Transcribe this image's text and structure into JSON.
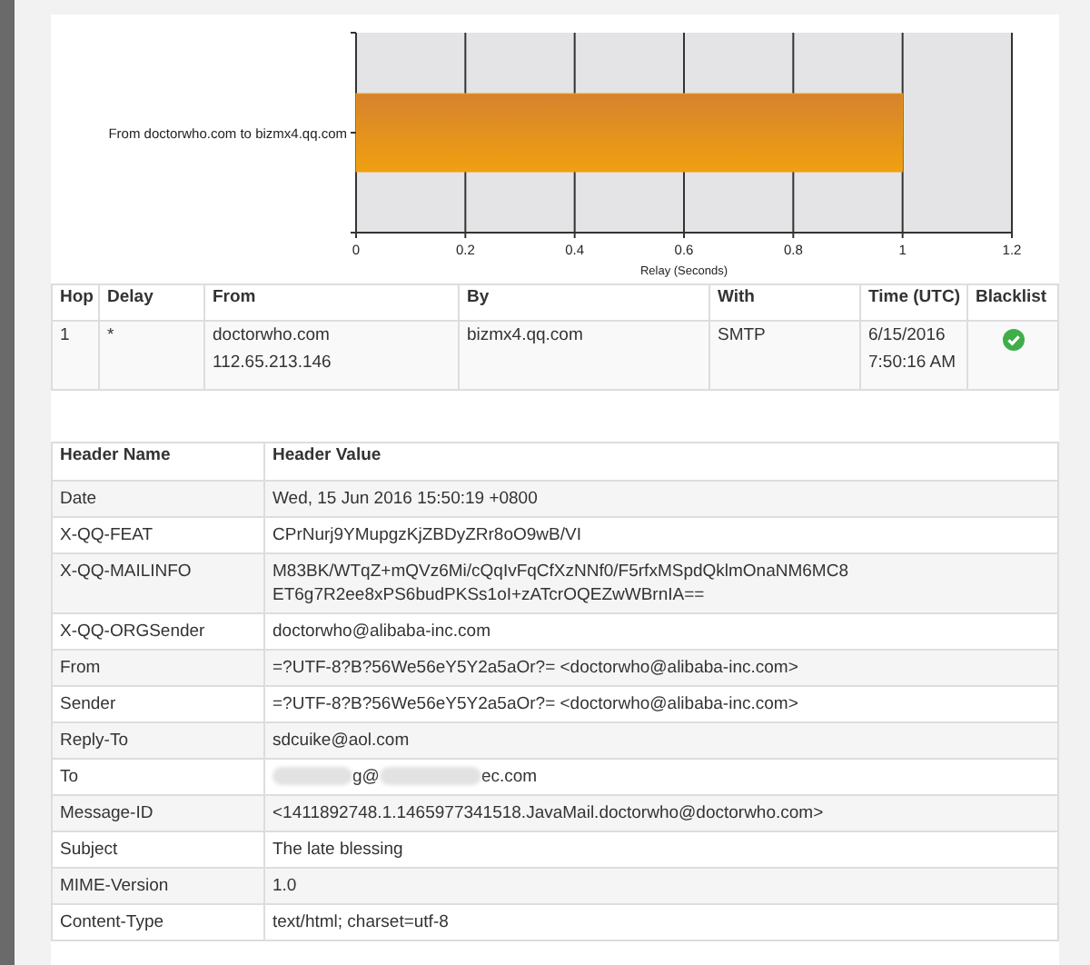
{
  "chart": {
    "chart_data": {
      "type": "bar",
      "orientation": "horizontal",
      "xlabel": "Relay (Seconds)",
      "categories": [
        "From doctorwho.com to bizmx4.qq.com"
      ],
      "series": [
        {
          "color": "#f0a010",
          "values": [
            1
          ]
        }
      ],
      "grid": true,
      "xlim": [
        0,
        1.2
      ],
      "xticks": [
        0,
        {
          "value": 0.2,
          "label": "0.2"
        },
        {
          "value": 0.4,
          "label": "0.4"
        },
        {
          "value": 0.6,
          "label": "0.6"
        },
        {
          "value": 0.8,
          "label": "0.8"
        },
        1,
        {
          "value": 1.2,
          "label": "1.2"
        }
      ]
    }
  },
  "hops": {
    "columns": [
      "Hop",
      "Delay",
      "From",
      "By",
      "With",
      "Time (UTC)",
      "Blacklist"
    ],
    "rows": [
      {
        "hop": "1",
        "delay": "*",
        "from": [
          "doctorwho.com",
          "112.65.213.146"
        ],
        "by": "bizmx4.qq.com",
        "with": "SMTP",
        "time": [
          "6/15/2016",
          "7:50:16 AM"
        ],
        "blacklisted": false
      }
    ]
  },
  "headers": {
    "columns": [
      "Header Name",
      "Header Value"
    ],
    "rows": [
      {
        "name": "Date",
        "value": [
          {
            "kind": "text",
            "text": "Wed, 15 Jun 2016 15:50:19 +0800"
          }
        ]
      },
      {
        "name": "X-QQ-FEAT",
        "value": [
          {
            "kind": "text",
            "text": "CPrNurj9YMupgzKjZBDyZRr8oO9wB/VI"
          }
        ]
      },
      {
        "name": "X-QQ-MAILINFO",
        "value": [
          {
            "kind": "text",
            "text": "M83BK/WTqZ+mQVz6Mi/cQqIvFqCfXzNNf0/F5rfxMSpdQklmOnaNM6MC8 ET6g7R2ee8xPS6budPKSs1oI+zATcrOQEZwWBrnIA=="
          }
        ]
      },
      {
        "name": "X-QQ-ORGSender",
        "value": [
          {
            "kind": "text",
            "text": "doctorwho@alibaba-inc.com"
          }
        ]
      },
      {
        "name": "From",
        "value": [
          {
            "kind": "text",
            "text": "=?UTF-8?B?56We56eY5Y2a5aOr?= <doctorwho@alibaba-inc.com>"
          }
        ]
      },
      {
        "name": "Sender",
        "value": [
          {
            "kind": "text",
            "text": "=?UTF-8?B?56We56eY5Y2a5aOr?= <doctorwho@alibaba-inc.com>"
          }
        ]
      },
      {
        "name": "Reply-To",
        "value": [
          {
            "kind": "text",
            "text": "sdcuike@aol.com"
          }
        ]
      },
      {
        "name": "To",
        "value": [
          {
            "kind": "redacted"
          },
          {
            "kind": "text",
            "text": "g@"
          },
          {
            "kind": "redacted"
          },
          {
            "kind": "text",
            "text": "ec.com"
          }
        ]
      },
      {
        "name": "Message-ID",
        "value": [
          {
            "kind": "text",
            "text": "<1411892748.1.1465977341518.JavaMail.doctorwho@doctorwho.com>"
          }
        ]
      },
      {
        "name": "Subject",
        "value": [
          {
            "kind": "text",
            "text": "The late blessing"
          }
        ]
      },
      {
        "name": "MIME-Version",
        "value": [
          {
            "kind": "text",
            "text": "1.0"
          }
        ]
      },
      {
        "name": "Content-Type",
        "value": [
          {
            "kind": "text",
            "text": "text/html; charset=utf-8"
          }
        ]
      }
    ]
  }
}
